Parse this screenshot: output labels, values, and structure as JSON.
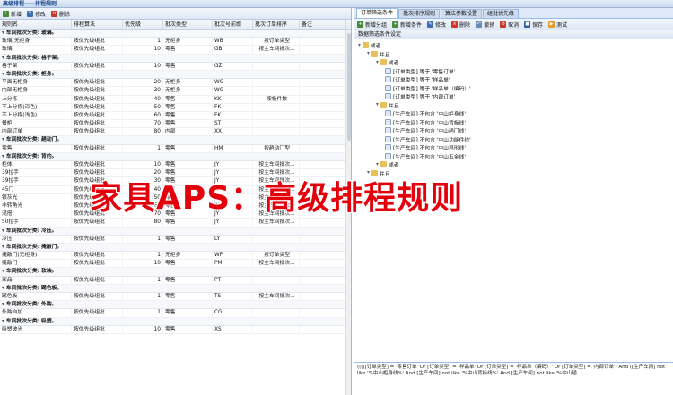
{
  "window": {
    "title": "高级排程——排程规则"
  },
  "left_toolbar": {
    "new": "新增",
    "edit": "修改",
    "delete": "删除"
  },
  "columns": [
    "规则名",
    "排程算法",
    "优先级",
    "批次类型",
    "批次号前缀",
    "批次订单排序",
    "备注"
  ],
  "rows": [
    {
      "type": "group",
      "label": "车间批次分类: 玻璃。"
    },
    {
      "type": "row",
      "cells": [
        "玻璃(无柜身)",
        "按优先级组批",
        "1",
        "无柜身",
        "WB",
        "按订单类型",
        ""
      ]
    },
    {
      "type": "row",
      "cells": [
        "玻璃",
        "按优先级组批",
        "10",
        "零售",
        "GB",
        "按主车间批次...",
        ""
      ]
    },
    {
      "type": "group",
      "label": "车间批次分类: 格子架。"
    },
    {
      "type": "row",
      "cells": [
        "格子架",
        "按优先级组批",
        "10",
        "零售",
        "GZ",
        "",
        ""
      ]
    },
    {
      "type": "group",
      "label": "车间批次分类: 柜身。"
    },
    {
      "type": "row",
      "cells": [
        "平面无柜身",
        "按优先级组批",
        "20",
        "无柜身",
        "WG",
        "",
        ""
      ]
    },
    {
      "type": "row",
      "cells": [
        "内部无柜身",
        "按优先级组批",
        "30",
        "无柜身",
        "WG",
        "",
        ""
      ]
    },
    {
      "type": "row",
      "cells": [
        "上分拣",
        "按优先级组批",
        "40",
        "零售",
        "KK",
        "按板件数",
        ""
      ]
    },
    {
      "type": "row",
      "cells": [
        "不上分拣(深色)",
        "按优先级组批",
        "50",
        "零售",
        "FK",
        "",
        ""
      ]
    },
    {
      "type": "row",
      "cells": [
        "不上分拣(浅色)",
        "按优先级组批",
        "60",
        "零售",
        "FK",
        "",
        ""
      ]
    },
    {
      "type": "row",
      "cells": [
        "餐柜",
        "按优先级组批",
        "70",
        "零售",
        "ST",
        "",
        ""
      ]
    },
    {
      "type": "row",
      "cells": [
        "内部订单",
        "按优先级组批",
        "80",
        "内部",
        "XX",
        "",
        ""
      ]
    },
    {
      "type": "group",
      "label": "车间批次分类: 趟动门。"
    },
    {
      "type": "row",
      "cells": [
        "零售",
        "按优先级组批",
        "1",
        "零售",
        "HM",
        "按趟动门型",
        ""
      ]
    },
    {
      "type": "group",
      "label": "车间批次分类: 背约。"
    },
    {
      "type": "row",
      "cells": [
        "柜体",
        "按优先级组批",
        "10",
        "零售",
        "JY",
        "按主车间批次...",
        ""
      ]
    },
    {
      "type": "row",
      "cells": [
        "39拉手",
        "按优先级组批",
        "20",
        "零售",
        "JY",
        "按主车间批次...",
        ""
      ]
    },
    {
      "type": "row",
      "cells": [
        "39拉手",
        "按优先级组批",
        "30",
        "零售",
        "JY",
        "按主车间批次...",
        ""
      ]
    },
    {
      "type": "row",
      "cells": [
        "45门",
        "按优先级组批",
        "40",
        "零售",
        "JY",
        "按主车间批次...",
        ""
      ]
    },
    {
      "type": "row",
      "cells": [
        "银灰光",
        "按优先级组批",
        "50",
        "零售",
        "JY",
        "按主车间批次...",
        ""
      ]
    },
    {
      "type": "row",
      "cells": [
        "非转角光",
        "按优先级组批",
        "60",
        "零售",
        "JY",
        "按主车间批次...",
        ""
      ]
    },
    {
      "type": "row",
      "cells": [
        "混搭",
        "按优先级组批",
        "70",
        "零售",
        "JY",
        "按主车间批次...",
        ""
      ]
    },
    {
      "type": "row",
      "cells": [
        "50拉手",
        "按优先级组批",
        "80",
        "零售",
        "JY",
        "按主车间批次...",
        ""
      ]
    },
    {
      "type": "group",
      "label": "车间批次分类: 冷压。"
    },
    {
      "type": "row",
      "cells": [
        "冷压",
        "按优先级组批",
        "1",
        "零售",
        "LY",
        "",
        ""
      ]
    },
    {
      "type": "group",
      "label": "车间批次分类: 掩敲门。"
    },
    {
      "type": "row",
      "cells": [
        "掩敲门(无柜身)",
        "按优先级组批",
        "1",
        "无柜身",
        "WP",
        "按订单类型",
        ""
      ]
    },
    {
      "type": "row",
      "cells": [
        "掩敲门",
        "按优先级组批",
        "10",
        "零售",
        "PM",
        "按主车间批次...",
        ""
      ]
    },
    {
      "type": "group",
      "label": "车间批次分类: 软装。"
    },
    {
      "type": "row",
      "cells": [
        "家品",
        "按优先级组批",
        "1",
        "零售",
        "PT",
        "",
        ""
      ]
    },
    {
      "type": "group",
      "label": "车间批次分类: 踢色板。"
    },
    {
      "type": "row",
      "cells": [
        "踢色板",
        "按优先级组批",
        "1",
        "零售",
        "TS",
        "按主车间批次...",
        ""
      ]
    },
    {
      "type": "group",
      "label": "车间批次分类: 外购。"
    },
    {
      "type": "row",
      "cells": [
        "外购自加",
        "按优先级组批",
        "1",
        "零售",
        "CG",
        "",
        ""
      ]
    },
    {
      "type": "group",
      "label": "车间批次分类: 吸塑。"
    },
    {
      "type": "row",
      "cells": [
        "吸塑玻光",
        "按优先级组批",
        "10",
        "零售",
        "XS",
        "",
        ""
      ]
    }
  ],
  "right_tabs": [
    "订单筛选条件",
    "批次排序规则",
    "算法参数设置",
    "组批优先级"
  ],
  "right_toolbar": {
    "add_group": "新增分组",
    "add_cond": "新增条件",
    "edit": "修改",
    "delete": "删除",
    "revoke": "撤销",
    "cancel": "取消",
    "save": "保存",
    "test": "测试"
  },
  "tree_title": "数据筛选条件设定",
  "tree": [
    {
      "level": 0,
      "kind": "folder",
      "text": "或者"
    },
    {
      "level": 1,
      "kind": "folder",
      "text": "并且"
    },
    {
      "level": 2,
      "kind": "folder",
      "text": "或者"
    },
    {
      "level": 3,
      "kind": "doc",
      "text": "[订单类型] 等于 '零售订单'"
    },
    {
      "level": 3,
      "kind": "doc",
      "text": "[订单类型] 等于 '样品单'"
    },
    {
      "level": 3,
      "kind": "doc",
      "text": "[订单类型] 等于 '样品单（编码）'"
    },
    {
      "level": 3,
      "kind": "doc",
      "text": "[订单类型] 等于 '内部订单'"
    },
    {
      "level": 2,
      "kind": "folder",
      "text": "并且"
    },
    {
      "level": 3,
      "kind": "doc",
      "text": "[生产车间] 不包含 '中山柜身线'"
    },
    {
      "level": 3,
      "kind": "doc",
      "text": "[生产车间] 不包含 '中山背板线'"
    },
    {
      "level": 3,
      "kind": "doc",
      "text": "[生产车间] 不包含 '中山趟门线'"
    },
    {
      "level": 3,
      "kind": "doc",
      "text": "[生产车间] 不包含 '中山功能件线'"
    },
    {
      "level": 3,
      "kind": "doc",
      "text": "[生产车间] 不包含 '中山异形线'"
    },
    {
      "level": 3,
      "kind": "doc",
      "text": "[生产车间] 不包含 '中山五金线'"
    },
    {
      "level": 2,
      "kind": "folder",
      "text": "或者"
    },
    {
      "level": 1,
      "kind": "folder",
      "text": "并且"
    }
  ],
  "bottom_text": "(((([订单类型] = '零售订单' Or [订单类型] = '样品单' Or [订单类型] = '样品单（编码）' Or [订单类型] = '内部订单') And ([生产车间] not like '%中山柜身线%' And [生产车间] not like '%中山背板线%' And [生产车间] not like '%中山趟",
  "overlay": "家具APS：高级排程规则"
}
